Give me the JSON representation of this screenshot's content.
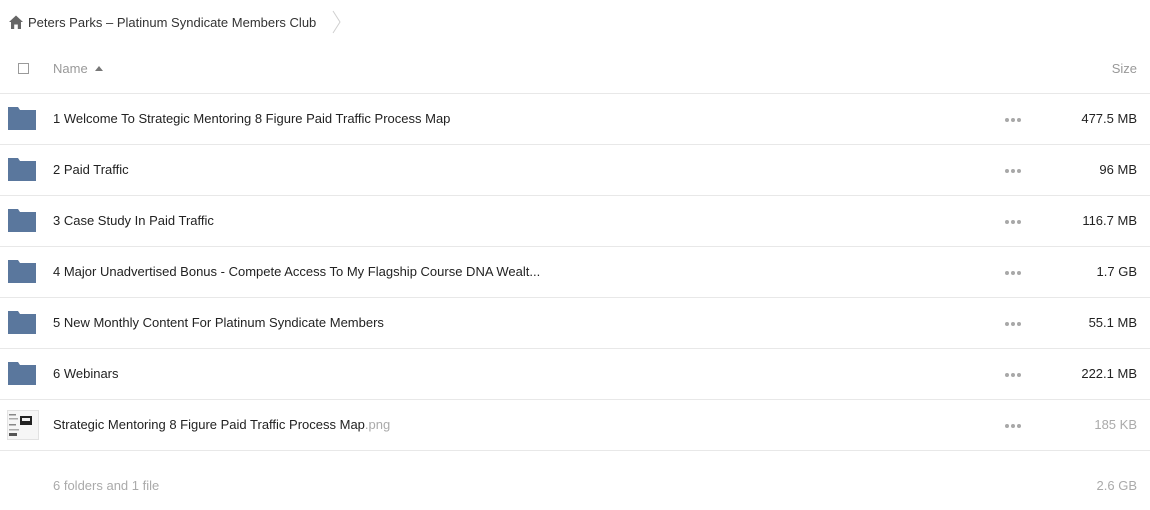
{
  "breadcrumb": {
    "home_icon": "home-icon",
    "title": "Peters Parks – Platinum Syndicate Members Club"
  },
  "columns": {
    "name": "Name",
    "size": "Size",
    "sort": "ascending"
  },
  "colors": {
    "folder": "#5a779d",
    "text": "#222222",
    "muted": "#aaaaaa",
    "divider": "#e8e8e8"
  },
  "rows": [
    {
      "name": "1 Welcome To Strategic Mentoring 8 Figure Paid Traffic Process Map",
      "ext": "",
      "size": "477.5 MB",
      "type": "folder"
    },
    {
      "name": "2 Paid Traffic",
      "ext": "",
      "size": "96 MB",
      "type": "folder"
    },
    {
      "name": "3 Case Study In Paid Traffic",
      "ext": "",
      "size": "116.7 MB",
      "type": "folder"
    },
    {
      "name": "4 Major Unadvertised Bonus - Compete Access To My Flagship Course DNA Wealt...",
      "ext": "",
      "size": "1.7 GB",
      "type": "folder"
    },
    {
      "name": "5 New Monthly Content For Platinum Syndicate Members",
      "ext": "",
      "size": "55.1 MB",
      "type": "folder"
    },
    {
      "name": "6 Webinars",
      "ext": "",
      "size": "222.1 MB",
      "type": "folder"
    },
    {
      "name": "Strategic Mentoring 8 Figure Paid Traffic Process Map",
      "ext": ".png",
      "size": "185 KB",
      "type": "file"
    }
  ],
  "summary": {
    "text": "6 folders and 1 file",
    "size": "2.6 GB"
  }
}
